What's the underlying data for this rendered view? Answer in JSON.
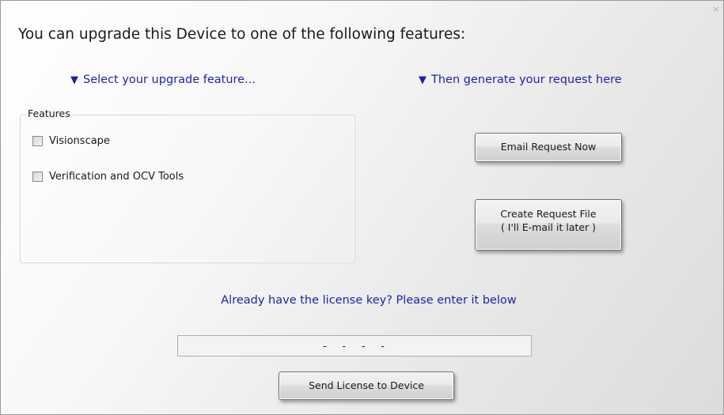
{
  "window": {
    "close_glyph": "×"
  },
  "heading": "You can upgrade this Device to one of the following features:",
  "hints": {
    "select_feature": "Select your upgrade feature...",
    "generate_request": "Then generate your request here",
    "license_prompt": "Already have the license key? Please enter it below",
    "arrow_glyph": "▼"
  },
  "features": {
    "legend": "Features",
    "items": [
      {
        "label": "Visionscape",
        "checked": false
      },
      {
        "label": "Verification and OCV Tools",
        "checked": false
      }
    ]
  },
  "buttons": {
    "email_request": "Email Request Now",
    "create_request_line1": "Create Request File",
    "create_request_line2": "( I'll E-mail it later )",
    "send_license": "Send License to Device"
  },
  "license_key": {
    "value": "-   -   -   -"
  }
}
